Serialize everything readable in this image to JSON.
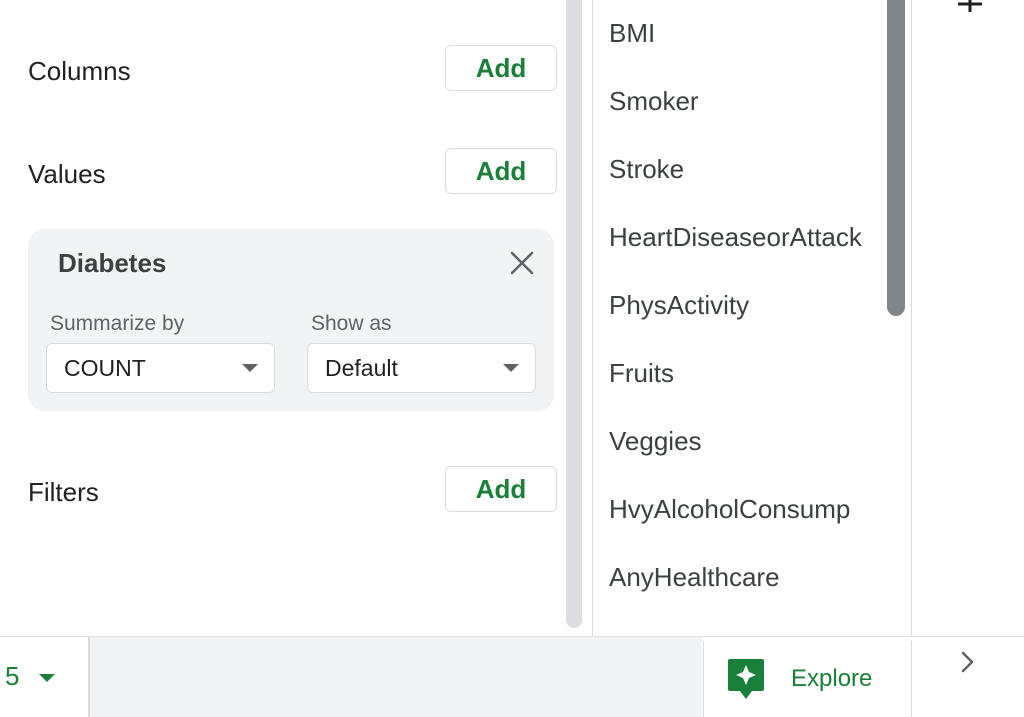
{
  "editor": {
    "columns": {
      "label": "Columns",
      "add_label": "Add"
    },
    "values": {
      "label": "Values",
      "add_label": "Add"
    },
    "filters": {
      "label": "Filters",
      "add_label": "Add"
    },
    "value_card": {
      "title": "Diabetes",
      "summarize_by_label": "Summarize by",
      "summarize_by_value": "COUNT",
      "show_as_label": "Show as",
      "show_as_value": "Default"
    }
  },
  "fields": {
    "items": [
      {
        "label": "BMI"
      },
      {
        "label": "Smoker"
      },
      {
        "label": "Stroke"
      },
      {
        "label": "HeartDiseaseorAttack"
      },
      {
        "label": "PhysActivity"
      },
      {
        "label": "Fruits"
      },
      {
        "label": "Veggies"
      },
      {
        "label": "HvyAlcoholConsump"
      },
      {
        "label": "AnyHealthcare"
      }
    ]
  },
  "bottom_bar": {
    "sheet_number": "5",
    "explore_label": "Explore"
  },
  "colors": {
    "accent_green": "#188038",
    "card_bg": "#f1f3f4",
    "border": "#dadce0",
    "scrollbar_thumb": "#80868b"
  },
  "icons": {
    "close": "close-icon",
    "dropdown": "chevron-down-icon",
    "explore": "explore-icon",
    "add": "plus-icon",
    "next": "chevron-right-icon"
  }
}
